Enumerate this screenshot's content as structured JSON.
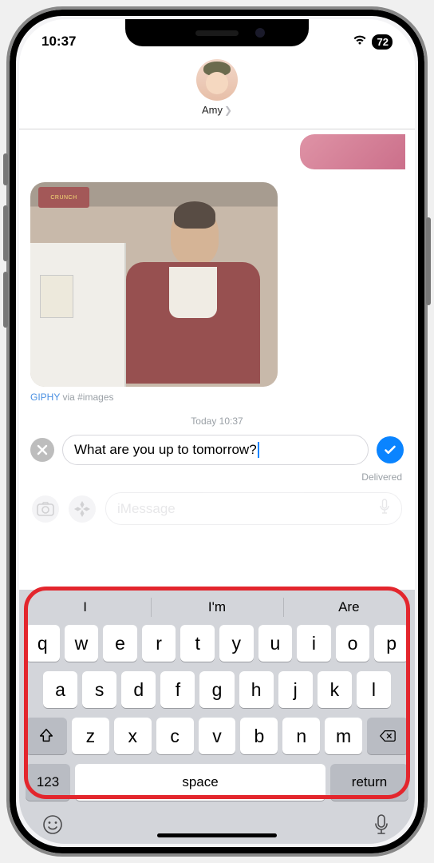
{
  "status": {
    "time": "10:37",
    "battery": "72"
  },
  "header": {
    "contact_name": "Amy"
  },
  "conversation": {
    "gif_attrib_source": "GIPHY",
    "gif_attrib_via": " via #images",
    "gif_box_text": "CRUNCH",
    "timestamp": "Today 10:37",
    "editing_text": "What are you up to tomorrow?",
    "delivered_label": "Delivered",
    "compose_placeholder": "iMessage"
  },
  "keyboard": {
    "predictions": [
      "I",
      "I'm",
      "Are"
    ],
    "row1": [
      "q",
      "w",
      "e",
      "r",
      "t",
      "y",
      "u",
      "i",
      "o",
      "p"
    ],
    "row2": [
      "a",
      "s",
      "d",
      "f",
      "g",
      "h",
      "j",
      "k",
      "l"
    ],
    "row3": [
      "z",
      "x",
      "c",
      "v",
      "b",
      "n",
      "m"
    ],
    "mode_key": "123",
    "space_key": "space",
    "return_key": "return"
  }
}
